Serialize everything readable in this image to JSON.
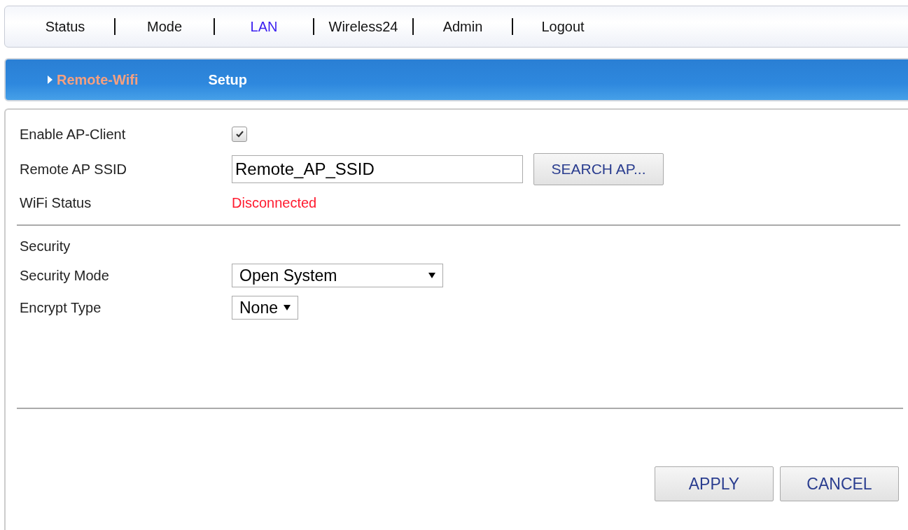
{
  "nav": [
    {
      "label": "Status",
      "selected": false
    },
    {
      "label": "Mode",
      "selected": false
    },
    {
      "label": "LAN",
      "selected": true
    },
    {
      "label": "Wireless24",
      "selected": false
    },
    {
      "label": "Admin",
      "selected": false
    },
    {
      "label": "Logout",
      "selected": false
    }
  ],
  "submenu": [
    {
      "label": "Remote-Wifi",
      "selected": true
    },
    {
      "label": "Setup",
      "selected": false
    }
  ],
  "wifi": {
    "enable_label": "Enable AP-Client",
    "enable_checked": true,
    "ssid_label": "Remote AP SSID",
    "ssid_value": "Remote_AP_SSID",
    "search_button": "SEARCH AP...",
    "status_label": "WiFi Status",
    "status_value": "Disconnected"
  },
  "security": {
    "heading": "Security",
    "mode_label": "Security Mode",
    "mode_value": "Open System",
    "encrypt_label": "Encrypt Type",
    "encrypt_value": "None"
  },
  "buttons": [
    "APPLY",
    "CANCEL"
  ]
}
